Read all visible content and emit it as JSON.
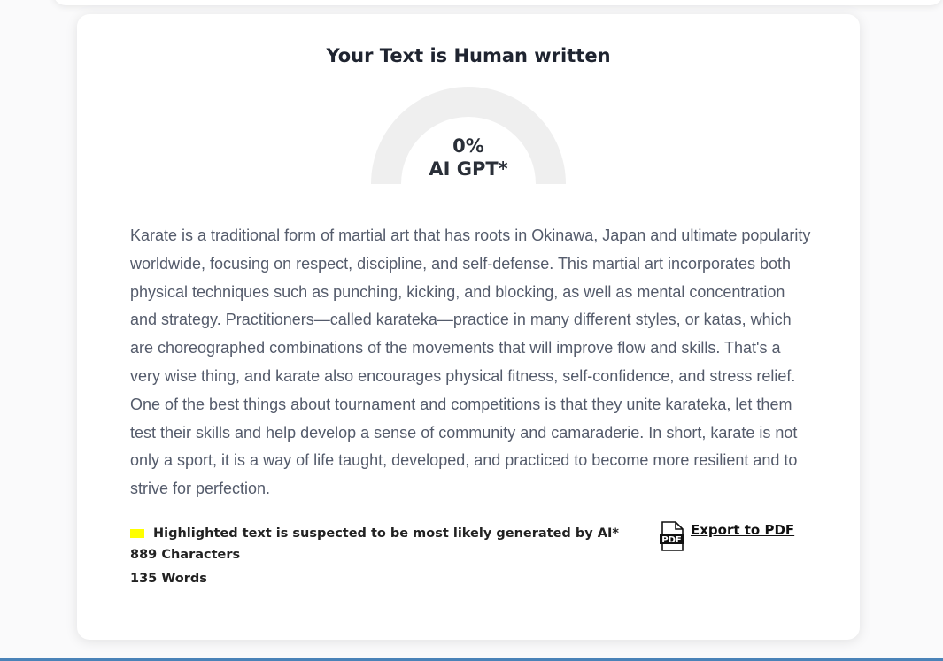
{
  "result": {
    "title": "Your Text is Human written",
    "gauge": {
      "percent_text": "0%",
      "label": "AI GPT*",
      "value": 0
    }
  },
  "analyzed_text": "Karate is a traditional form of martial art that has roots in Okinawa, Japan and ultimate popularity worldwide, focusing on respect, discipline, and self-defense. This martial art incorporates both physical techniques such as punching, kicking, and blocking, as well as mental concentration and strategy. Practitioners—called karateka—practice in many different styles, or katas, which are choreographed combinations of the movements that will improve flow and skills. That's a very wise thing, and karate also encourages physical fitness, self-confidence, and stress relief. One of the best things about tournament and competitions is that they unite karateka, let them test their skills and help develop a sense of community and camaraderie. In short, karate is not only a sport, it is a way of life taught, developed, and practiced to become more resilient and to strive for perfection.",
  "legend": {
    "text": "Highlighted text is suspected to be most likely generated by AI*",
    "swatch_color": "#ffff00"
  },
  "stats": {
    "characters": "889 Characters",
    "words": "135 Words"
  },
  "export": {
    "label": "Export to PDF",
    "icon": "pdf-file-icon"
  },
  "colors": {
    "gauge_track": "#efefef",
    "text": "#545b6b",
    "accent_line": "#4a83b8"
  }
}
